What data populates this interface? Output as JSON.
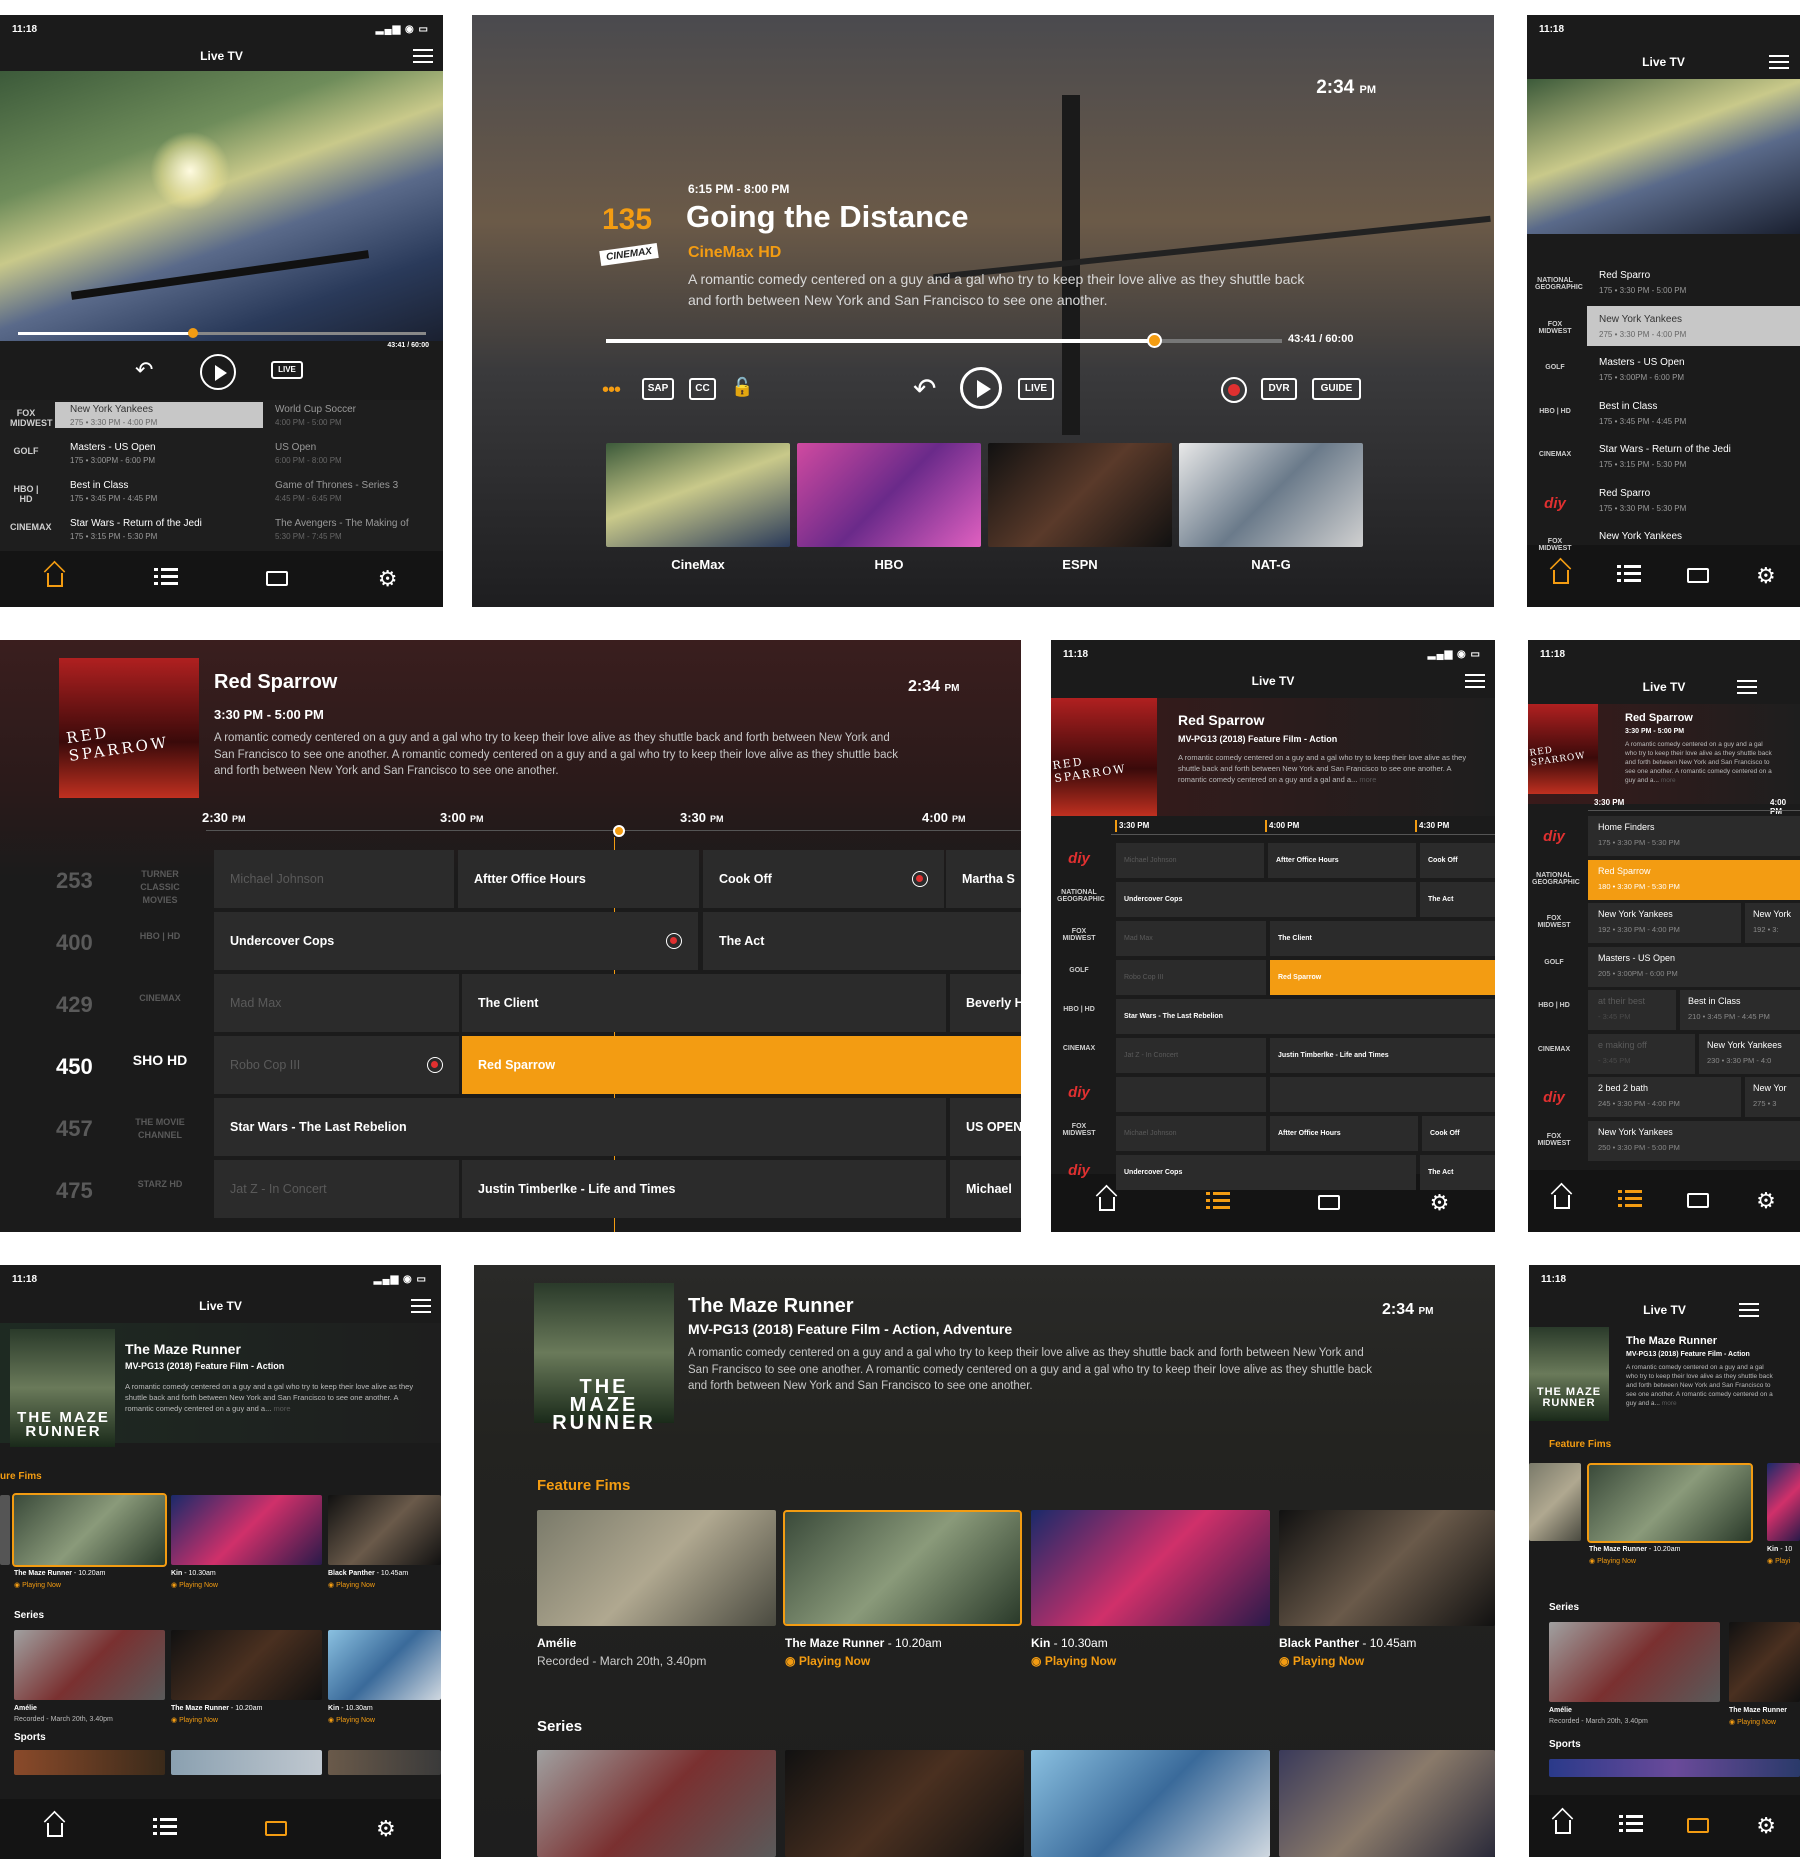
{
  "phone": {
    "time": "11:18",
    "title": "Live TV"
  },
  "tablet": {
    "time": "2:34",
    "pm": "PM"
  },
  "p1": {
    "progress_time": "43:41 / 60:00",
    "live": "LIVE",
    "progress": 0.43,
    "rows": [
      {
        "logo": "FOX MIDWEST",
        "title": "New York Yankees",
        "sub": "275  •  3:30 PM - 4:00 PM",
        "next": "World Cup Soccer",
        "next_sub": "4:00 PM - 5:00 PM"
      },
      {
        "logo": "GOLF",
        "title": "Masters  -  US Open",
        "sub": "175  •  3:00PM - 6:00 PM",
        "next": "US Open",
        "next_sub": "6:00 PM - 8:00 PM"
      },
      {
        "logo": "HBO | HD",
        "title": "Best in Class",
        "sub": "175  •  3:45 PM - 4:45 PM",
        "next": "Game of Thrones - Series 3",
        "next_sub": "4:45 PM - 6:45 PM"
      },
      {
        "logo": "CINEMAX",
        "title": "Star Wars  -  Return of the Jedi",
        "sub": "175  •  3:15 PM - 5:30 PM",
        "next": "The Avengers - The Making of",
        "next_sub": "5:30 PM - 7:45 PM"
      }
    ]
  },
  "p2": {
    "channel": "135",
    "network_logo": "CINEMAX",
    "time_range": "6:15 PM - 8:00 PM",
    "title": "Going the Distance",
    "network": "CineMax HD",
    "desc": "A romantic comedy centered on a guy and a gal who try to keep their love alive as they shuttle back and forth between New York and San Francisco to see one another.",
    "progress_time": "43:41 / 60:00",
    "progress": 0.81,
    "buttons": {
      "sap": "SAP",
      "cc": "CC",
      "live": "LIVE",
      "dvr": "DVR",
      "guide": "GUIDE"
    },
    "channels": [
      "CineMax",
      "HBO",
      "ESPN",
      "NAT-G"
    ]
  },
  "p3": {
    "rows": [
      {
        "logo": "NATIONAL GEOGRAPHIC",
        "title": "Red Sparro",
        "sub": "175  •  3:30 PM - 5:00 PM"
      },
      {
        "logo": "FOX MIDWEST",
        "title": "New York Yankees",
        "sub": "275  •  3:30 PM - 4:00 PM"
      },
      {
        "logo": "GOLF",
        "title": "Masters  -  US Open",
        "sub": "175  •  3:00PM - 6:00 PM"
      },
      {
        "logo": "HBO | HD",
        "title": "Best in Class",
        "sub": "175  •  3:45 PM - 4:45 PM"
      },
      {
        "logo": "CINEMAX",
        "title": "Star Wars  -  Return of the Jedi",
        "sub": "175  •  3:15 PM - 5:30 PM"
      },
      {
        "logo": "diy",
        "title": "Red Sparro",
        "sub": "175  •  3:30 PM - 5:30 PM"
      },
      {
        "logo": "FOX MIDWEST",
        "title": "New York Yankees",
        "sub": ""
      }
    ]
  },
  "p4": {
    "poster": "RED SPARROW",
    "title": "Red Sparrow",
    "time_range": "3:30 PM - 5:00 PM",
    "desc": "A romantic comedy centered on a guy and a gal who try to keep their love alive as they shuttle back and forth between New York and San Francisco to see one another. A romantic comedy centered on a guy and a gal who try to keep their love alive as they shuttle back and forth between New York and San Francisco to see one another.",
    "times": [
      "2:30 PM",
      "3:00 PM",
      "3:30 PM",
      "4:00 PM"
    ],
    "channels": [
      {
        "num": "253",
        "logo": "TURNER CLASSIC MOVIES"
      },
      {
        "num": "400",
        "logo": "HBO | HD"
      },
      {
        "num": "429",
        "logo": "CINEMAX"
      },
      {
        "num": "450",
        "logo": "SHO HD"
      },
      {
        "num": "457",
        "logo": "THE MOVIE CHANNEL"
      },
      {
        "num": "475",
        "logo": "STARZ HD"
      }
    ],
    "cells": [
      "Michael Johnson",
      "Aftter Office Hours",
      "Cook Off",
      "Martha S",
      "Undercover Cops",
      "The Act",
      "Mad Max",
      "The Client",
      "Beverly H",
      "Robo Cop III",
      "Red Sparrow",
      "Star Wars - The Last Rebelion",
      "US OPEN",
      "Jat Z - In Concert",
      "Justin Timberlke - Life and Times",
      "Michael"
    ]
  },
  "p5": {
    "title": "Red Sparrow",
    "meta": "MV-PG13 (2018) Feature Film - Action",
    "desc": "A romantic comedy centered on a guy and a gal who try to keep their love alive as they shuttle back and forth between New York and San Francisco to see one another. A romantic comedy centered on a guy and a gal and a...",
    "more": "more",
    "times": [
      "3:30 PM",
      "4:00 PM",
      "4:30 PM"
    ],
    "logos": [
      "diy",
      "NATIONAL GEOGRAPHIC",
      "FOX MIDWEST",
      "GOLF",
      "HBO | HD",
      "CINEMAX",
      "diy",
      "FOX MIDWEST",
      "diy"
    ],
    "cells": [
      "Michael Johnson",
      "Aftter Office Hours",
      "Cook Off",
      "Undercover Cops",
      "The Act",
      "Mad Max",
      "The Client",
      "Robo Cop III",
      "Red Sparrow",
      "Star Wars - The Last Rebelion",
      "Jat Z - In Concert",
      "Justin Timberlke - Life and Times",
      "Michael Johnson",
      "Aftter Office Hours",
      "Cook Off",
      "Undercover Cops",
      "The Act"
    ]
  },
  "p6": {
    "title": "Red Sparrow",
    "time_range": "3:30 PM - 5:00 PM",
    "desc": "A romantic comedy centered on a guy and a gal who try to keep their love alive as they shuttle back and forth between New York and San Francisco to see one another. A romantic comedy centered on a guy and a...",
    "more": "more",
    "times": [
      "3:30 PM",
      "4:00 PM"
    ],
    "rows": [
      {
        "logo": "diy",
        "title": "Home Finders",
        "sub": "175  •  3:30 PM - 5:30 PM"
      },
      {
        "logo": "NATIONAL GEOGRAPHIC",
        "title": "Red Sparrow",
        "sub": "180  •  3:30 PM - 5:30 PM"
      },
      {
        "logo": "FOX MIDWEST",
        "title": "New York Yankees",
        "sub": "192  •  3:30 PM - 4:00 PM",
        "n2": "New York",
        "n2s": "192  •  3:"
      },
      {
        "logo": "GOLF",
        "title": "Masters  -  US Open",
        "sub": "205  •  3:00PM - 6:00 PM"
      },
      {
        "logo": "HBO | HD",
        "title": "at their best",
        "sub": "- 3:45 PM",
        "n2": "Best in Class",
        "n2s": "210  •  3:45 PM - 4:45 PM"
      },
      {
        "logo": "CINEMAX",
        "title": "e making off",
        "sub": "- 3:45 PM",
        "n2": "New York Yankees",
        "n2s": "230  •  3:30 PM - 4:0"
      },
      {
        "logo": "diy",
        "title": "2 bed 2 bath",
        "sub": "245  •  3:30 PM - 4:00 PM",
        "n2": "New Yor",
        "n2s": "275  •  3"
      },
      {
        "logo": "FOX MIDWEST",
        "title": "New York Yankees",
        "sub": "250  •  3:30 PM - 5:00 PM"
      }
    ]
  },
  "p7": {
    "poster": "THE MAZE RUNNER",
    "title": "The Maze Runner",
    "meta": "MV-PG13 (2018) Feature Film - Action",
    "desc": "A romantic comedy centered on a guy and a gal who try to keep their love alive as they shuttle back and forth between New York and San Francisco to see one another. A romantic comedy centered on a guy and a...",
    "more": "more",
    "section1": "ure Fims",
    "section2": "Series",
    "section3": "Sports",
    "films": [
      {
        "title": "The Maze Runner",
        "time": "10.20am",
        "status": "Playing Now"
      },
      {
        "title": "Kin",
        "time": "10.30am",
        "status": "Playing Now"
      },
      {
        "title": "Black Panther",
        "time": "10.45am",
        "status": "Playing Now"
      }
    ],
    "series": [
      {
        "title": "Amélie",
        "sub": "Recorded  -  March 20th, 3.40pm"
      },
      {
        "title": "The Maze Runner",
        "time": "10.20am",
        "status": "Playing Now"
      },
      {
        "title": "Kin",
        "time": "10.30am",
        "status": "Playing Now"
      }
    ]
  },
  "p8": {
    "poster": "THE MAZE RUNNER",
    "title": "The Maze Runner",
    "meta": "MV-PG13  (2018)  Feature Film  -  Action, Adventure",
    "desc": "A romantic comedy centered on a guy and a gal who try to keep their love alive as they shuttle back and forth between New York and San Francisco to see one another. A romantic comedy centered on a guy and a gal who try to keep their love alive as they shuttle back and forth between New York and San Francisco to see one another.",
    "section1": "Feature Fims",
    "section2": "Series",
    "films": [
      {
        "title": "Amélie",
        "sub": "Recorded  -  March 20th, 3.40pm"
      },
      {
        "title": "The Maze Runner",
        "time": "10.20am",
        "status": "Playing Now"
      },
      {
        "title": "Kin",
        "time": "10.30am",
        "status": "Playing Now"
      },
      {
        "title": "Black Panther",
        "time": "10.45am",
        "status": "Playing Now"
      }
    ]
  },
  "p9": {
    "title": "The Maze Runner",
    "meta": "MV-PG13 (2018) Feature Film - Action",
    "desc": "A romantic comedy centered on a guy and a gal who try to keep their love alive as they shuttle back and forth between New York and San Francisco to see one another. A romantic comedy centered on a guy and a...",
    "more": "more",
    "section1": "Feature Fims",
    "section2": "Series",
    "section3": "Sports",
    "films": [
      {
        "title": "The Maze Runner",
        "time": "10.20am",
        "status": "Playing Now"
      },
      {
        "title": "Kin",
        "time": "10",
        "status": "Playi"
      }
    ],
    "series": [
      {
        "title": "Amélie",
        "sub": "Recorded  -  March 20th, 3.40pm"
      },
      {
        "title": "The Maze Runner",
        "status": "Playing Now"
      }
    ]
  },
  "tabs": [
    "home-icon",
    "list-icon",
    "tv-icon",
    "gear-icon"
  ],
  "colors": {
    "accent": "#f39c12",
    "bg": "#1b1b1b",
    "cell": "#2b2b2b",
    "record": "#e03030"
  }
}
